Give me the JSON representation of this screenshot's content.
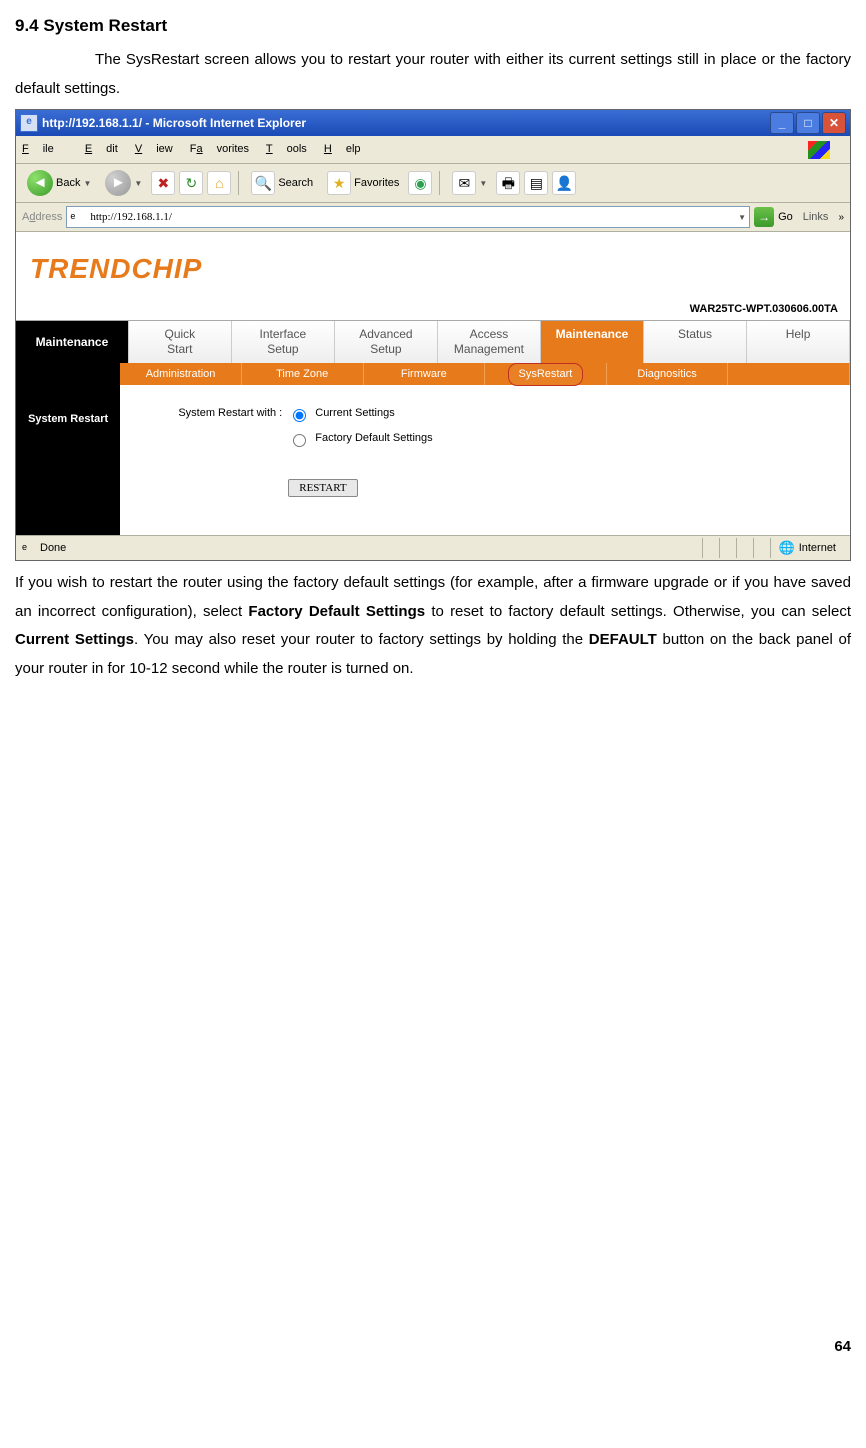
{
  "doc": {
    "heading": "9.4 System Restart",
    "intro": "The SysRestart screen allows you to restart your router with either its current settings still in place or the factory default settings.",
    "after_part1": "If you wish to restart the router using the factory default settings (for example, after a firmware upgrade or if you have saved an incorrect configuration), select ",
    "bold1": "Factory Default Settings",
    "after_part2": " to reset to factory default settings. Otherwise, you can select ",
    "bold2": "Current Settings",
    "after_part3": ". You may also reset your router to factory settings by holding the ",
    "bold3": "DEFAULT",
    "after_part4": " button on the back panel of your router in for 10-12 second while the router is turned on.",
    "page_number": "64"
  },
  "browser": {
    "title": "http://192.168.1.1/ - Microsoft Internet Explorer",
    "menus": {
      "file": "File",
      "edit": "Edit",
      "view": "View",
      "favorites": "Favorites",
      "tools": "Tools",
      "help": "Help"
    },
    "toolbar": {
      "back": "Back",
      "search": "Search",
      "favorites": "Favorites"
    },
    "address_label": "Address",
    "url": "http://192.168.1.1/",
    "go": "Go",
    "links": "Links",
    "status_done": "Done",
    "status_zone": "Internet"
  },
  "router": {
    "brand": "TRENDCHIP",
    "version": "WAR25TC-WPT.030606.00TA",
    "tabs": {
      "side": "Maintenance",
      "quick": "Quick\nStart",
      "interface": "Interface\nSetup",
      "advanced": "Advanced\nSetup",
      "access": "Access\nManagement",
      "maintenance": "Maintenance",
      "status": "Status",
      "help": "Help"
    },
    "subtabs": {
      "admin": "Administration",
      "time": "Time Zone",
      "firmware": "Firmware",
      "sysrestart": "SysRestart",
      "diag": "Diagnositics"
    },
    "side_title": "System Restart",
    "form_label": "System Restart with :",
    "option1": "Current Settings",
    "option2": "Factory Default Settings",
    "restart_btn": "RESTART"
  }
}
